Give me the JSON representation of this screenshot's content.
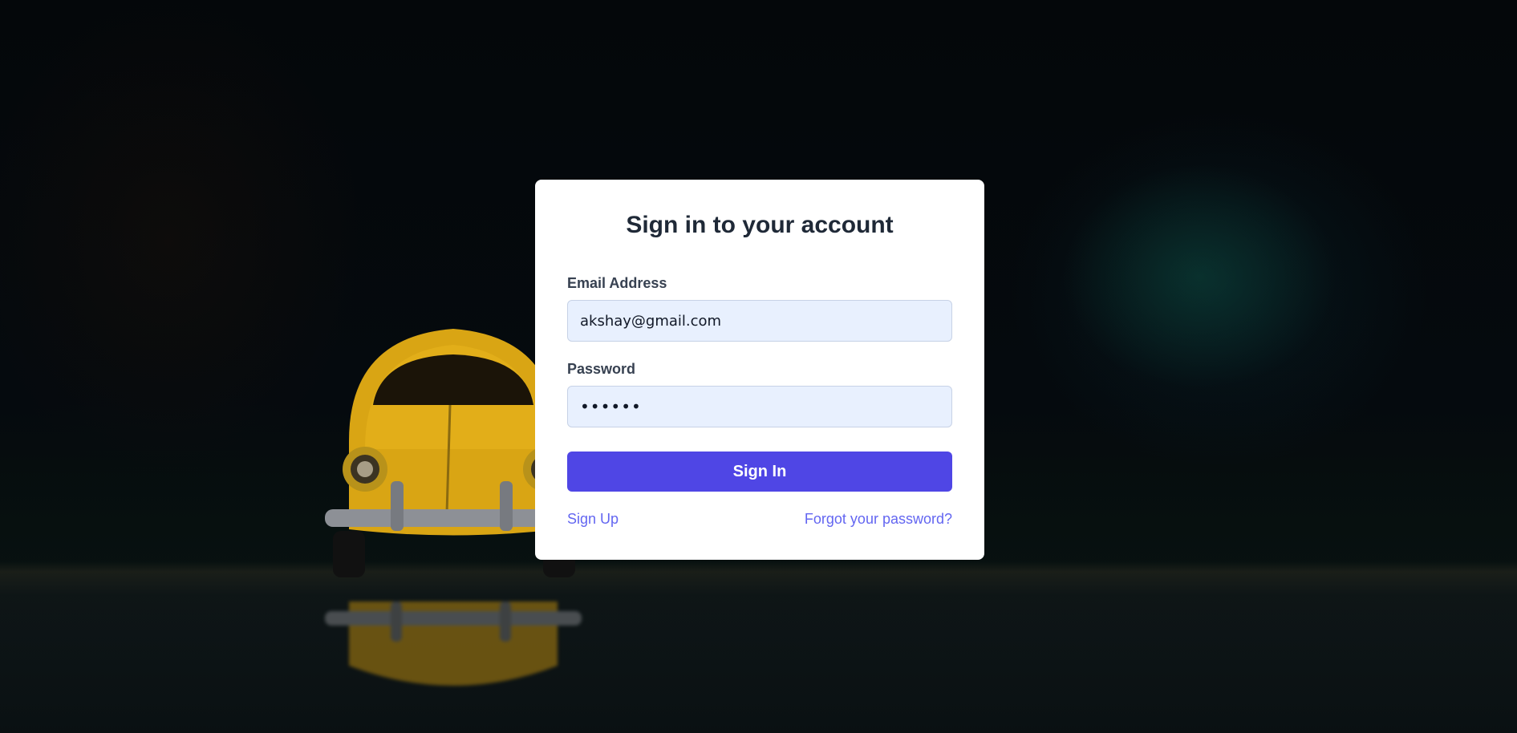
{
  "login": {
    "title": "Sign in to your account",
    "email_label": "Email Address",
    "email_value": "akshay@gmail.com",
    "password_label": "Password",
    "password_value": "123456",
    "signin_label": "Sign In",
    "signup_label": "Sign Up",
    "forgot_label": "Forgot your password?"
  },
  "colors": {
    "accent": "#4f46e5",
    "link": "#6366f1",
    "input_bg": "#e8f0fe",
    "card_bg": "#ffffff"
  },
  "background": {
    "image": "yellow-toy-car-photo"
  }
}
